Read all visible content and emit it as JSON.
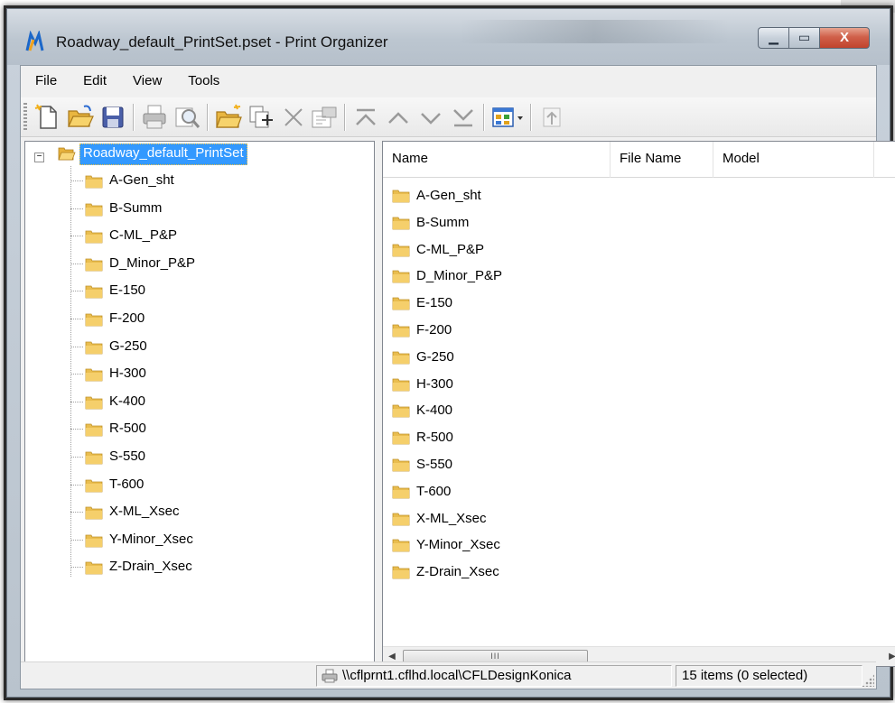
{
  "window": {
    "title": "Roadway_default_PrintSet.pset - Print Organizer",
    "minimize_glyph": "▁",
    "maximize_glyph": "▭",
    "close_glyph": "X"
  },
  "menubar": {
    "items": [
      {
        "label": "File"
      },
      {
        "label": "Edit"
      },
      {
        "label": "View"
      },
      {
        "label": "Tools"
      }
    ]
  },
  "toolbar": {
    "buttons": [
      {
        "icon": "new-document-icon"
      },
      {
        "icon": "open-folder-icon"
      },
      {
        "icon": "save-icon"
      },
      {
        "icon": "print-icon"
      },
      {
        "icon": "print-preview-icon"
      },
      {
        "icon": "new-folder-icon"
      },
      {
        "icon": "add-files-icon"
      },
      {
        "icon": "delete-icon"
      },
      {
        "icon": "properties-icon"
      },
      {
        "icon": "move-to-top-icon"
      },
      {
        "icon": "move-up-icon"
      },
      {
        "icon": "move-down-icon"
      },
      {
        "icon": "move-to-bottom-icon"
      },
      {
        "icon": "view-options-icon"
      },
      {
        "icon": "up-level-icon"
      }
    ]
  },
  "tree": {
    "root_label": "Roadway_default_PrintSet",
    "expander_glyph": "−",
    "items": [
      {
        "label": "A-Gen_sht"
      },
      {
        "label": "B-Summ"
      },
      {
        "label": "C-ML_P&P"
      },
      {
        "label": "D_Minor_P&P"
      },
      {
        "label": "E-150"
      },
      {
        "label": "F-200"
      },
      {
        "label": "G-250"
      },
      {
        "label": "H-300"
      },
      {
        "label": "K-400"
      },
      {
        "label": "R-500"
      },
      {
        "label": "S-550"
      },
      {
        "label": "T-600"
      },
      {
        "label": "X-ML_Xsec"
      },
      {
        "label": "Y-Minor_Xsec"
      },
      {
        "label": "Z-Drain_Xsec"
      }
    ]
  },
  "list": {
    "columns": {
      "name": "Name",
      "file_name": "File Name",
      "model": "Model"
    },
    "items": [
      {
        "label": "A-Gen_sht"
      },
      {
        "label": "B-Summ"
      },
      {
        "label": "C-ML_P&P"
      },
      {
        "label": "D_Minor_P&P"
      },
      {
        "label": "E-150"
      },
      {
        "label": "F-200"
      },
      {
        "label": "G-250"
      },
      {
        "label": "H-300"
      },
      {
        "label": "K-400"
      },
      {
        "label": "R-500"
      },
      {
        "label": "S-550"
      },
      {
        "label": "T-600"
      },
      {
        "label": "X-ML_Xsec"
      },
      {
        "label": "Y-Minor_Xsec"
      },
      {
        "label": "Z-Drain_Xsec"
      }
    ],
    "scroll_left_glyph": "◀",
    "scroll_right_glyph": "▶",
    "thumb_glyph": "III"
  },
  "status": {
    "printer": "\\\\cflprnt1.cflhd.local\\CFLDesignKonica",
    "count": "15 items (0 selected)"
  },
  "colors": {
    "selection": "#3399ff",
    "folder": "#f5cf6b",
    "close_button": "#c9432c"
  }
}
